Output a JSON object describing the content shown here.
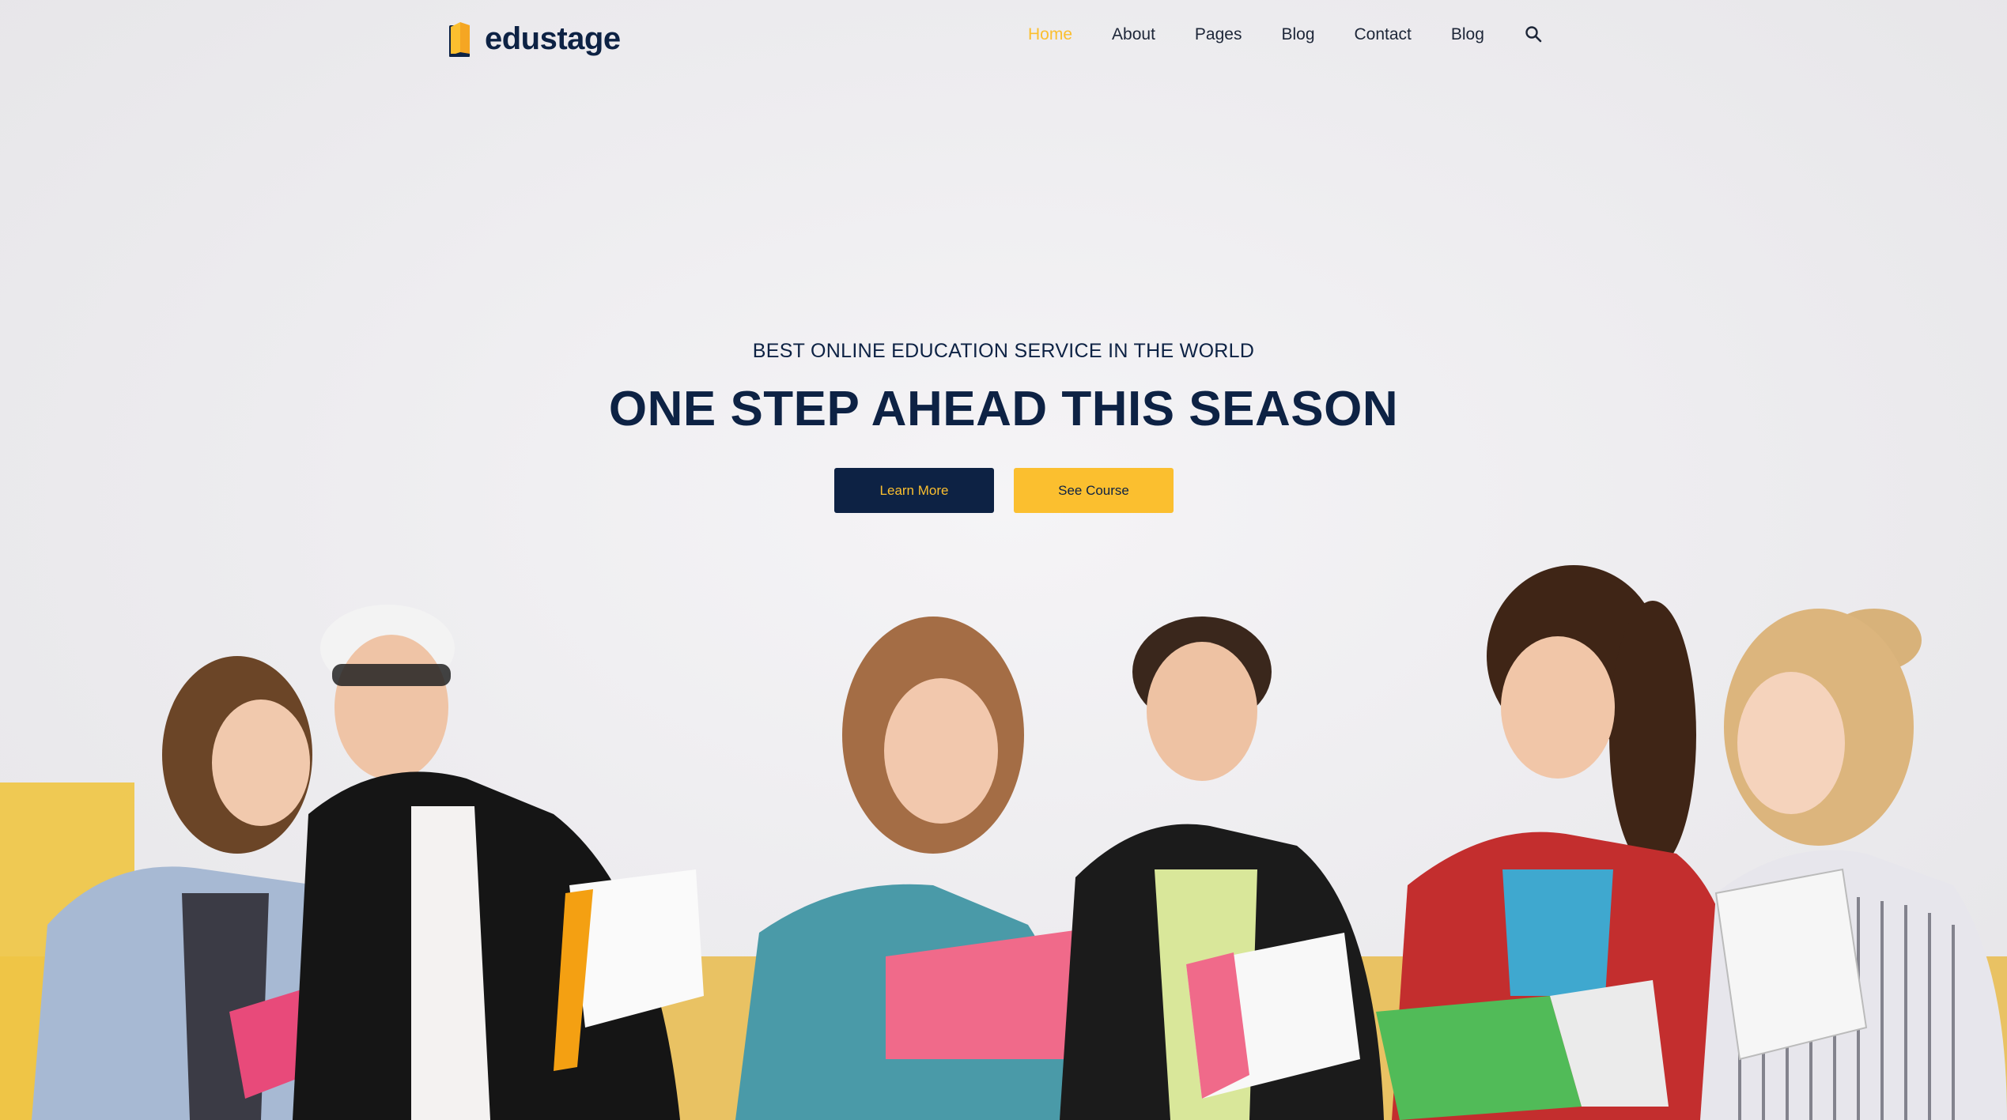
{
  "brand": {
    "name": "edustage"
  },
  "nav": {
    "items": [
      {
        "label": "Home",
        "active": true
      },
      {
        "label": "About",
        "active": false
      },
      {
        "label": "Pages",
        "active": false
      },
      {
        "label": "Blog",
        "active": false
      },
      {
        "label": "Contact",
        "active": false
      },
      {
        "label": "Blog",
        "active": false
      }
    ],
    "search_icon": "search-icon"
  },
  "hero": {
    "subtitle": "BEST ONLINE EDUCATION SERVICE IN THE WORLD",
    "title": "ONE STEP AHEAD THIS SEASON",
    "primary_button": "Learn More",
    "secondary_button": "See Course"
  },
  "colors": {
    "navy": "#0d2244",
    "accent": "#fbbf2f",
    "background": "#ebe9ec"
  }
}
